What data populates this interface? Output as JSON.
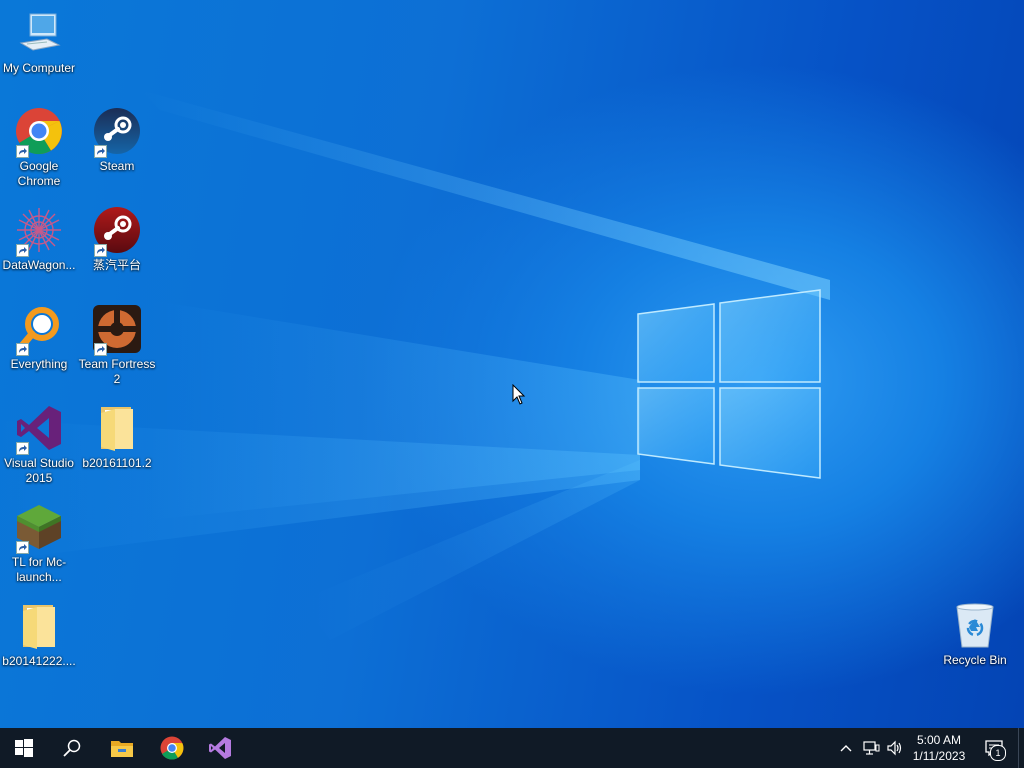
{
  "desktop": {
    "wallpaper": "windows-10-hero",
    "icons": [
      {
        "label": "My Computer",
        "icon": "computer-icon"
      },
      {
        "label": "Google Chrome",
        "icon": "chrome-icon"
      },
      {
        "label": "Steam",
        "icon": "steam-icon"
      },
      {
        "label": "DataWagon...",
        "icon": "datawagon-icon"
      },
      {
        "label": "蒸汽平台",
        "icon": "steam-china-icon"
      },
      {
        "label": "Everything",
        "icon": "everything-icon"
      },
      {
        "label": "Team Fortress 2",
        "icon": "tf2-icon"
      },
      {
        "label": "Visual Studio 2015",
        "icon": "visual-studio-icon"
      },
      {
        "label": "b20161101.2",
        "icon": "folder-icon"
      },
      {
        "label": "TL for Mc-launch...",
        "icon": "minecraft-icon"
      },
      {
        "label": "b20141222....",
        "icon": "folder-icon"
      },
      {
        "label": "Recycle Bin",
        "icon": "recycle-bin-icon"
      }
    ]
  },
  "taskbar": {
    "pinned": [
      "start-icon",
      "search-icon",
      "file-explorer-icon",
      "chrome-icon",
      "visual-studio-icon"
    ],
    "tray": {
      "time": "5:00 AM",
      "date": "1/11/2023",
      "notification_count": "1"
    }
  },
  "colors": {
    "taskbar": "#101a26",
    "wallpaper_blue": "#0a78d8",
    "active_indicator": "#76b9ed"
  }
}
